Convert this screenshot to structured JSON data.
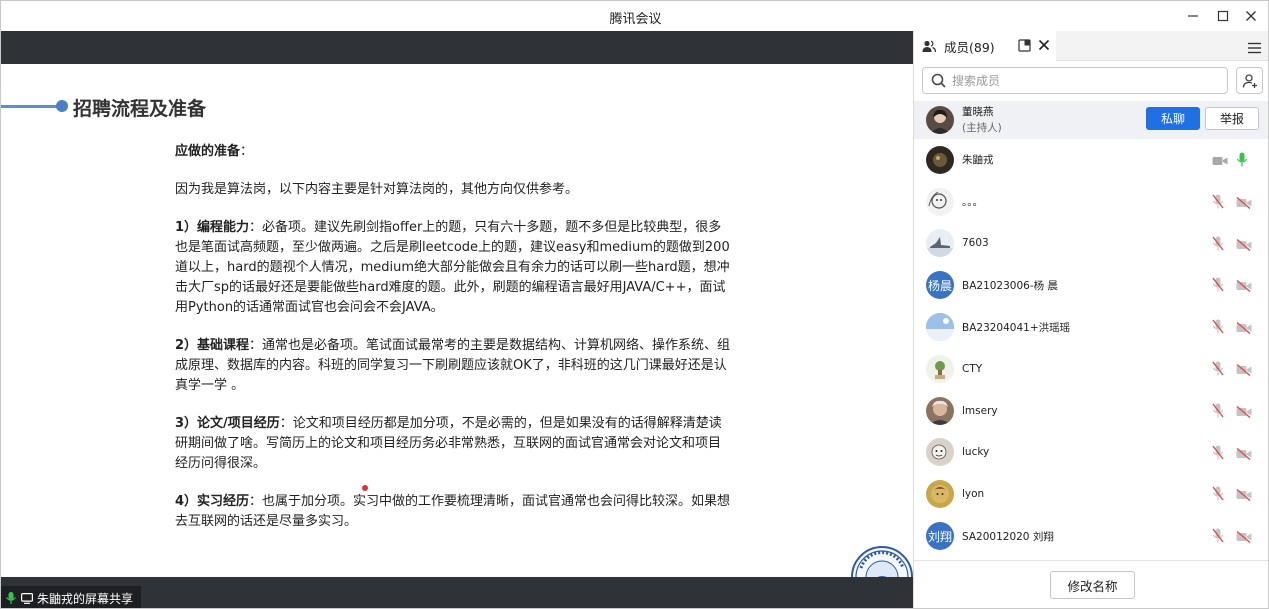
{
  "window": {
    "title": "腾讯会议"
  },
  "slide": {
    "title": "招聘流程及准备",
    "prep_label": "应做的准备",
    "prep_colon": "：",
    "intro": "因为我是算法岗，以下内容主要是针对算法岗的，其他方向仅供参考。",
    "sections": [
      {
        "heading": "1）编程能力",
        "body": "：必备项。建议先刷剑指offer上的题，只有六十多题，题不多但是比较典型，很多也是笔面试高频题，至少做两遍。之后是刷leetcode上的题，建议easy和medium的题做到200道以上，hard的题视个人情况，medium绝大部分能做会且有余力的话可以刷一些hard题，想冲击大厂sp的话最好还是要能做些hard难度的题。此外，刷题的编程语言最好用JAVA/C++，面试用Python的话通常面试官也会问会不会JAVA。"
      },
      {
        "heading": "2）基础课程",
        "body": "：通常也是必备项。笔试面试最常考的主要是数据结构、计算机网络、操作系统、组成原理、数据库的内容。科班的同学复习一下刷刷题应该就OK了，非科班的这几门课最好还是认真学一学 。"
      },
      {
        "heading": "3）论文/项目经历",
        "body": "：论文和项目经历都是加分项，不是必需的，但是如果没有的话得解释清楚读研期间做了啥。写简历上的论文和项目经历务必非常熟悉，互联网的面试官通常会对论文和项目经历问得很深。"
      },
      {
        "heading": "4）实习经历",
        "body": "：也属于加分项。实习中做的工作要梳理清晰，面试官通常也会问得比较深。如果想去互联网的话还是尽量多实习。"
      }
    ]
  },
  "share_label": "朱鼬戎的屏幕共享",
  "panel": {
    "tab_label": "成员(89)",
    "search_placeholder": "搜索成员",
    "host": {
      "name": "董晓燕",
      "role": "(主持人)",
      "chat_label": "私聊",
      "report_label": "举报"
    },
    "members": [
      {
        "name": "朱鼬戎",
        "avatar": "",
        "avatar_color": "#3a3226",
        "camera": "on",
        "mic": "on"
      },
      {
        "name": "。。。",
        "avatar": "",
        "avatar_color": "#f2f2f2",
        "camera": "off",
        "mic": "off"
      },
      {
        "name": "7603",
        "avatar": "",
        "avatar_color": "#dfe7ee",
        "camera": "off",
        "mic": "off"
      },
      {
        "name": "BA21023006-杨 晨",
        "avatar": "杨晨",
        "avatar_color": "#3b73c4",
        "camera": "off",
        "mic": "off"
      },
      {
        "name": "BA23204041+洪瑶瑶",
        "avatar": "",
        "avatar_color": "#a8c6e6",
        "camera": "off",
        "mic": "off"
      },
      {
        "name": "CTY",
        "avatar": "",
        "avatar_color": "#e9efe2",
        "camera": "off",
        "mic": "off"
      },
      {
        "name": "lmsery",
        "avatar": "",
        "avatar_color": "#8a7460",
        "camera": "off",
        "mic": "off"
      },
      {
        "name": "lucky",
        "avatar": "",
        "avatar_color": "#c9c2b8",
        "camera": "off",
        "mic": "off"
      },
      {
        "name": "lyon",
        "avatar": "",
        "avatar_color": "#c8a64a",
        "camera": "off",
        "mic": "off"
      },
      {
        "name": "SA20012020 刘翔",
        "avatar": "刘翔",
        "avatar_color": "#3b73c4",
        "camera": "off",
        "mic": "off"
      }
    ],
    "rename_label": "修改名称"
  }
}
